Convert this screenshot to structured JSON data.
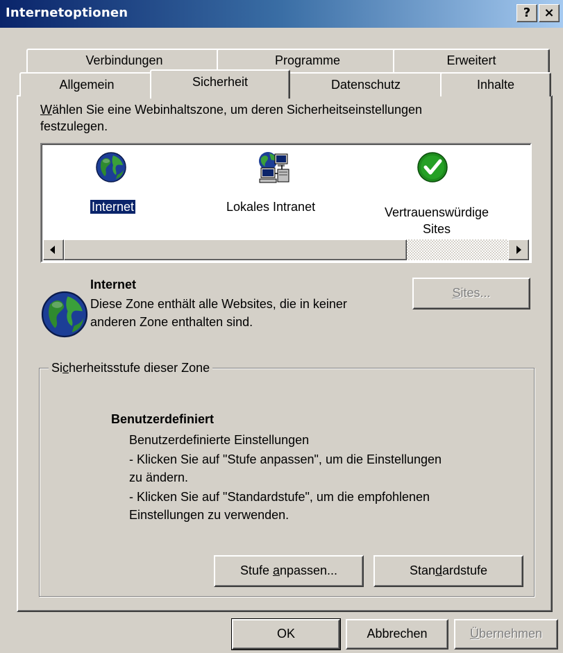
{
  "window": {
    "title": "Internetoptionen",
    "help_button": "?",
    "close_button": "×"
  },
  "tabs": {
    "row_back": [
      {
        "label": "Verbindungen"
      },
      {
        "label": "Programme"
      },
      {
        "label": "Erweitert"
      }
    ],
    "row_front": [
      {
        "label": "Allgemein"
      },
      {
        "label": "Sicherheit",
        "active": true
      },
      {
        "label": "Datenschutz"
      },
      {
        "label": "Inhalte"
      }
    ]
  },
  "security": {
    "intro_prefix": "W",
    "intro_rest": "ählen Sie eine Webinhaltszone, um deren Sicherheitseinstellungen",
    "intro_line2": "festzulegen.",
    "zones": [
      {
        "label": "Internet",
        "icon": "globe-icon",
        "selected": true
      },
      {
        "label": "Lokales Intranet",
        "icon": "intranet-computers-icon"
      },
      {
        "label_line1": "Vertrauenswürdige",
        "label_line2": "Sites",
        "icon": "checkmark-icon"
      }
    ],
    "zone_info": {
      "name": "Internet",
      "desc_line1": "Diese Zone enthält alle Websites, die in keiner",
      "desc_line2": "anderen Zone enthalten sind."
    },
    "sites_button": {
      "prefix": "S",
      "rest": "ites..."
    },
    "level_group": {
      "legend_pre": "Si",
      "legend_u": "c",
      "legend_post": "herheitsstufe dieser Zone",
      "level_name": "Benutzerdefiniert",
      "lines": [
        "Benutzerdefinierte Einstellungen",
        "- Klicken Sie auf \"Stufe anpassen\", um die Einstellungen",
        "zu ändern.",
        "- Klicken Sie auf \"Standardstufe\", um die empfohlenen",
        "Einstellungen zu verwenden."
      ]
    },
    "custom_level_button": {
      "pre": "Stufe ",
      "u": "a",
      "post": "npassen..."
    },
    "default_level_button": {
      "pre": "Stan",
      "u": "d",
      "post": "ardstufe"
    }
  },
  "footer": {
    "ok": "OK",
    "cancel": "Abbrechen",
    "apply_u": "Ü",
    "apply_rest": "bernehmen"
  },
  "colors": {
    "titlebar_start": "#0a246a",
    "titlebar_end": "#a6caf0",
    "face": "#d4d0c8",
    "selection": "#0a246a"
  }
}
